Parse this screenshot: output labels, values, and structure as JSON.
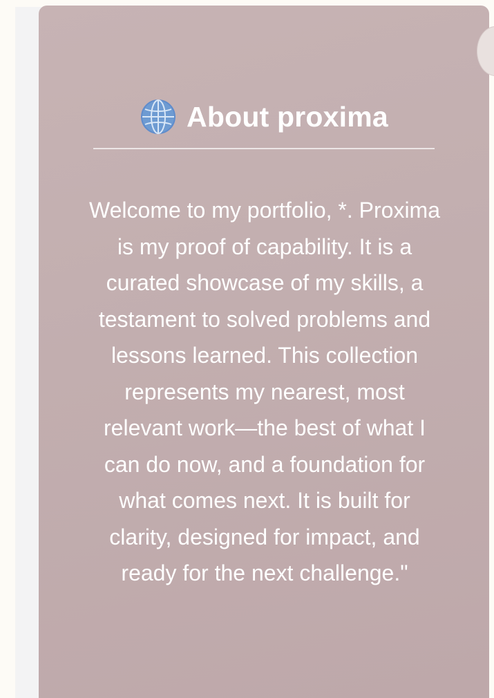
{
  "about": {
    "title": "About proxima",
    "icon": "globe-icon",
    "text": "Welcome to my portfolio, *. Proxima is my proof of capability. It is a curated showcase of my skills, a testament to solved problems and lessons learned. This collection represents my nearest, most relevant work—the best of what I can do now, and a foundation for what comes next. It is built for clarity, designed for impact, and ready for the next challenge.\""
  },
  "colors": {
    "card_background": "#c3afb0",
    "title_text": "#ffffff",
    "body_text": "#ffffff",
    "icon_blue": "#6e9bd2",
    "page_background": "#fdfbf6"
  }
}
